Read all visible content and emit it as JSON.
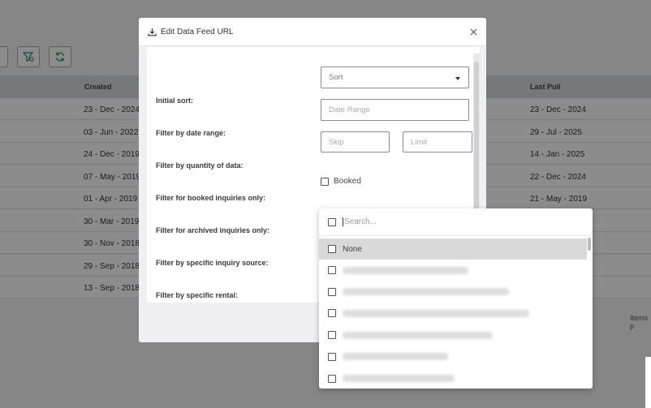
{
  "background": {
    "table": {
      "headers": {
        "created": "Created",
        "last_pull": "Last Pull"
      },
      "rows": [
        {
          "created": "23 - Dec - 2024",
          "last_pull": "23 - Dec - 2024"
        },
        {
          "created": "03 - Jun - 2022",
          "last_pull": "29 - Jul - 2025"
        },
        {
          "created": "24 - Dec - 2019",
          "last_pull": "14 - Jan - 2025"
        },
        {
          "created": "07 - May - 2019",
          "last_pull": "22 - Dec - 2024"
        },
        {
          "created": "01 - Apr - 2019",
          "last_pull": "21 - May - 2019"
        },
        {
          "created": "30 - Mar - 2019",
          "last_pull": ""
        },
        {
          "created": "30 - Nov - 2018",
          "last_pull": ""
        },
        {
          "created": "29 - Sep - 2018",
          "last_pull": ""
        },
        {
          "created": "13 - Sep - 2018",
          "last_pull": ""
        }
      ]
    },
    "items_text": "Items p"
  },
  "modal": {
    "title": "Edit Data Feed URL",
    "icon": "download-icon",
    "fields": {
      "initial_sort": {
        "label": "Initial sort:",
        "value": "Sort"
      },
      "date_range": {
        "label": "Filter by date range:",
        "placeholder": "Date Range"
      },
      "quantity": {
        "label": "Filter by quantity of data:",
        "skip_placeholder": "Skip",
        "limit_placeholder": "Limit"
      },
      "booked": {
        "label": "Filter for booked inquiries only:",
        "checkbox_label": "Booked"
      },
      "archived": {
        "label": "Filter for archived inquiries only:"
      },
      "source": {
        "label": "Filter by specific inquiry source:"
      },
      "rental": {
        "label": "Filter by specific rental:"
      }
    }
  },
  "dropdown": {
    "search_placeholder": "Search...",
    "items": [
      {
        "label": "None",
        "selected": true
      },
      {
        "label": ""
      },
      {
        "label": ""
      },
      {
        "label": ""
      },
      {
        "label": ""
      },
      {
        "label": ""
      },
      {
        "label": ""
      }
    ]
  }
}
